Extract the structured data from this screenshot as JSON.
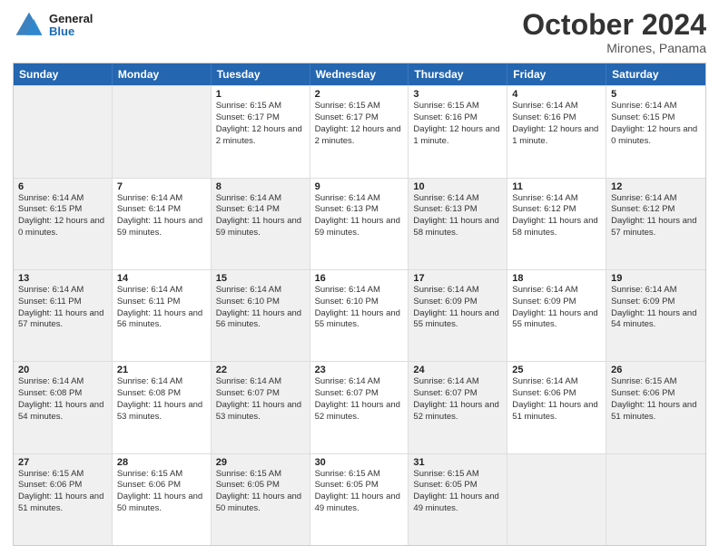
{
  "header": {
    "logo_line1": "General",
    "logo_line2": "Blue",
    "month": "October 2024",
    "location": "Mirones, Panama"
  },
  "days_of_week": [
    "Sunday",
    "Monday",
    "Tuesday",
    "Wednesday",
    "Thursday",
    "Friday",
    "Saturday"
  ],
  "weeks": [
    [
      {
        "day": "",
        "info": "",
        "shaded": true
      },
      {
        "day": "",
        "info": "",
        "shaded": true
      },
      {
        "day": "1",
        "info": "Sunrise: 6:15 AM\nSunset: 6:17 PM\nDaylight: 12 hours and 2 minutes."
      },
      {
        "day": "2",
        "info": "Sunrise: 6:15 AM\nSunset: 6:17 PM\nDaylight: 12 hours and 2 minutes."
      },
      {
        "day": "3",
        "info": "Sunrise: 6:15 AM\nSunset: 6:16 PM\nDaylight: 12 hours and 1 minute."
      },
      {
        "day": "4",
        "info": "Sunrise: 6:14 AM\nSunset: 6:16 PM\nDaylight: 12 hours and 1 minute."
      },
      {
        "day": "5",
        "info": "Sunrise: 6:14 AM\nSunset: 6:15 PM\nDaylight: 12 hours and 0 minutes."
      }
    ],
    [
      {
        "day": "6",
        "info": "Sunrise: 6:14 AM\nSunset: 6:15 PM\nDaylight: 12 hours and 0 minutes.",
        "shaded": true
      },
      {
        "day": "7",
        "info": "Sunrise: 6:14 AM\nSunset: 6:14 PM\nDaylight: 11 hours and 59 minutes."
      },
      {
        "day": "8",
        "info": "Sunrise: 6:14 AM\nSunset: 6:14 PM\nDaylight: 11 hours and 59 minutes.",
        "shaded": true
      },
      {
        "day": "9",
        "info": "Sunrise: 6:14 AM\nSunset: 6:13 PM\nDaylight: 11 hours and 59 minutes."
      },
      {
        "day": "10",
        "info": "Sunrise: 6:14 AM\nSunset: 6:13 PM\nDaylight: 11 hours and 58 minutes.",
        "shaded": true
      },
      {
        "day": "11",
        "info": "Sunrise: 6:14 AM\nSunset: 6:12 PM\nDaylight: 11 hours and 58 minutes."
      },
      {
        "day": "12",
        "info": "Sunrise: 6:14 AM\nSunset: 6:12 PM\nDaylight: 11 hours and 57 minutes.",
        "shaded": true
      }
    ],
    [
      {
        "day": "13",
        "info": "Sunrise: 6:14 AM\nSunset: 6:11 PM\nDaylight: 11 hours and 57 minutes.",
        "shaded": true
      },
      {
        "day": "14",
        "info": "Sunrise: 6:14 AM\nSunset: 6:11 PM\nDaylight: 11 hours and 56 minutes."
      },
      {
        "day": "15",
        "info": "Sunrise: 6:14 AM\nSunset: 6:10 PM\nDaylight: 11 hours and 56 minutes.",
        "shaded": true
      },
      {
        "day": "16",
        "info": "Sunrise: 6:14 AM\nSunset: 6:10 PM\nDaylight: 11 hours and 55 minutes."
      },
      {
        "day": "17",
        "info": "Sunrise: 6:14 AM\nSunset: 6:09 PM\nDaylight: 11 hours and 55 minutes.",
        "shaded": true
      },
      {
        "day": "18",
        "info": "Sunrise: 6:14 AM\nSunset: 6:09 PM\nDaylight: 11 hours and 55 minutes."
      },
      {
        "day": "19",
        "info": "Sunrise: 6:14 AM\nSunset: 6:09 PM\nDaylight: 11 hours and 54 minutes.",
        "shaded": true
      }
    ],
    [
      {
        "day": "20",
        "info": "Sunrise: 6:14 AM\nSunset: 6:08 PM\nDaylight: 11 hours and 54 minutes.",
        "shaded": true
      },
      {
        "day": "21",
        "info": "Sunrise: 6:14 AM\nSunset: 6:08 PM\nDaylight: 11 hours and 53 minutes."
      },
      {
        "day": "22",
        "info": "Sunrise: 6:14 AM\nSunset: 6:07 PM\nDaylight: 11 hours and 53 minutes.",
        "shaded": true
      },
      {
        "day": "23",
        "info": "Sunrise: 6:14 AM\nSunset: 6:07 PM\nDaylight: 11 hours and 52 minutes."
      },
      {
        "day": "24",
        "info": "Sunrise: 6:14 AM\nSunset: 6:07 PM\nDaylight: 11 hours and 52 minutes.",
        "shaded": true
      },
      {
        "day": "25",
        "info": "Sunrise: 6:14 AM\nSunset: 6:06 PM\nDaylight: 11 hours and 51 minutes."
      },
      {
        "day": "26",
        "info": "Sunrise: 6:15 AM\nSunset: 6:06 PM\nDaylight: 11 hours and 51 minutes.",
        "shaded": true
      }
    ],
    [
      {
        "day": "27",
        "info": "Sunrise: 6:15 AM\nSunset: 6:06 PM\nDaylight: 11 hours and 51 minutes.",
        "shaded": true
      },
      {
        "day": "28",
        "info": "Sunrise: 6:15 AM\nSunset: 6:06 PM\nDaylight: 11 hours and 50 minutes."
      },
      {
        "day": "29",
        "info": "Sunrise: 6:15 AM\nSunset: 6:05 PM\nDaylight: 11 hours and 50 minutes.",
        "shaded": true
      },
      {
        "day": "30",
        "info": "Sunrise: 6:15 AM\nSunset: 6:05 PM\nDaylight: 11 hours and 49 minutes."
      },
      {
        "day": "31",
        "info": "Sunrise: 6:15 AM\nSunset: 6:05 PM\nDaylight: 11 hours and 49 minutes.",
        "shaded": true
      },
      {
        "day": "",
        "info": "",
        "shaded": true
      },
      {
        "day": "",
        "info": "",
        "shaded": true
      }
    ]
  ]
}
